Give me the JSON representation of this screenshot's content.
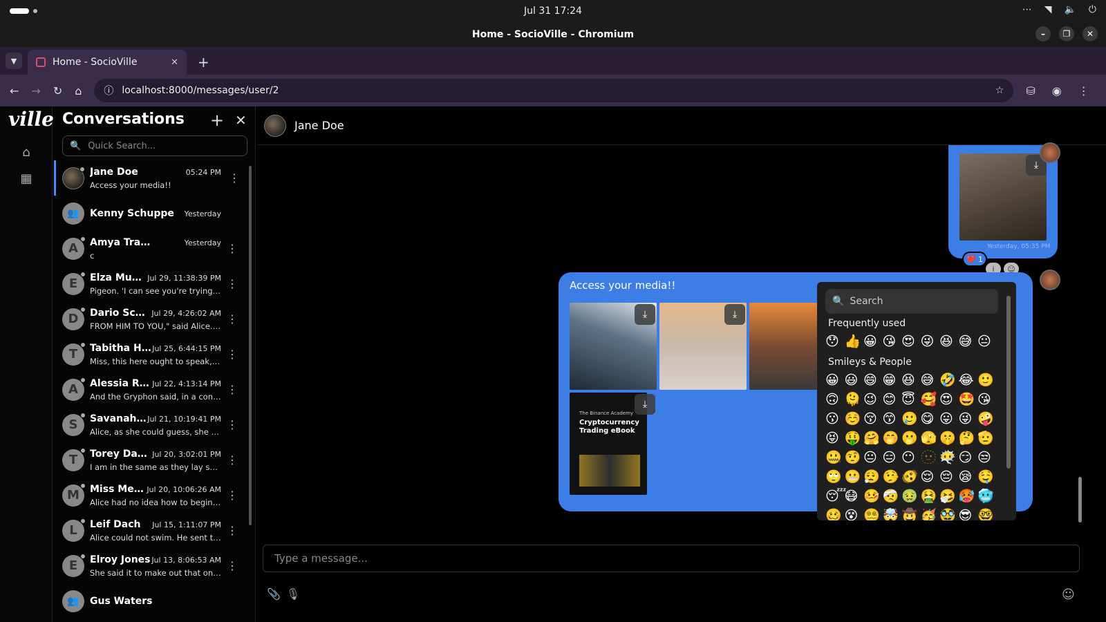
{
  "system": {
    "clock": "Jul 31  17:24",
    "tray": [
      "⋯",
      "wifi",
      "volume",
      "power"
    ]
  },
  "window": {
    "title": "Home - SocioVille - Chromium"
  },
  "browser": {
    "tab_title": "Home - SocioVille",
    "url": "localhost:8000/messages/user/2",
    "newtab_label": "+"
  },
  "app": {
    "logo": "ville"
  },
  "sidebar": {
    "title": "Conversations",
    "search_placeholder": "Quick Search...",
    "items": [
      {
        "name": "Jane Doe",
        "time": "05:24 PM",
        "preview": "Access your media!!",
        "initial": "",
        "kind": "photo"
      },
      {
        "name": "Kenny Schuppe",
        "time": "Yesterday",
        "preview": "",
        "initial": "",
        "kind": "group"
      },
      {
        "name": "Amya Trantow",
        "time": "Yesterday",
        "preview": "c",
        "initial": "A",
        "kind": "letter"
      },
      {
        "name": "Elza Mueller",
        "time": "Jul 29, 11:38:39 PM",
        "preview": "Pigeon. 'I can see you're trying t...",
        "initial": "E",
        "kind": "letter"
      },
      {
        "name": "Dario Schu...",
        "time": "Jul 29, 4:26:02 AM",
        "preview": "FROM HIM TO YOU,\" said Alice. ...",
        "initial": "D",
        "kind": "letter"
      },
      {
        "name": "Tabitha Ha...",
        "time": "Jul 25, 6:44:15 PM",
        "preview": "Miss, this here ought to speak, b...",
        "initial": "T",
        "kind": "letter"
      },
      {
        "name": "Alessia Rob...",
        "time": "Jul 22, 4:13:14 PM",
        "preview": "And the Gryphon said, in a confu...",
        "initial": "A",
        "kind": "letter"
      },
      {
        "name": "Savanah Tr...",
        "time": "Jul 21, 10:19:41 PM",
        "preview": "Alice, as she could guess, she wa...",
        "initial": "S",
        "kind": "letter"
      },
      {
        "name": "Torey Davis",
        "time": "Jul 20, 3:02:01 PM",
        "preview": "I am in the same as they lay spra...",
        "initial": "T",
        "kind": "letter"
      },
      {
        "name": "Miss Meg...",
        "time": "Jul 20, 10:06:26 AM",
        "preview": "Alice had no idea how to begin.' ...",
        "initial": "M",
        "kind": "letter"
      },
      {
        "name": "Leif Dach",
        "time": "Jul 15, 1:11:07 PM",
        "preview": "Alice could not swim. He sent th...",
        "initial": "L",
        "kind": "letter"
      },
      {
        "name": "Elroy Jones",
        "time": "Jul 13, 8:06:53 AM",
        "preview": "She said it to make out that one ...",
        "initial": "E",
        "kind": "letter"
      },
      {
        "name": "Gus Waters",
        "time": "",
        "preview": "",
        "initial": "",
        "kind": "group"
      }
    ]
  },
  "chat": {
    "contact_name": "Jane Doe",
    "message1": {
      "timestamp": "Yesterday, 05:35 PM",
      "reaction": "❤️",
      "reaction_count": "1"
    },
    "message2": {
      "text": "Access your media!!",
      "ebook": {
        "brand": "The Binance Academy",
        "title": "Cryptocurrency Trading eBook"
      }
    },
    "composer_placeholder": "Type a message..."
  },
  "emoji_picker": {
    "search_placeholder": "Search",
    "categories": [
      {
        "label": "Frequently used",
        "emojis": [
          "😯",
          "👍",
          "😀",
          "😘",
          "😍",
          "😜",
          "😆",
          "😅",
          "😐"
        ]
      },
      {
        "label": "Smileys & People",
        "emojis": [
          "😀",
          "😃",
          "😄",
          "😁",
          "😆",
          "😅",
          "🤣",
          "😂",
          "🙂",
          "🙃",
          "🫠",
          "😉",
          "😊",
          "😇",
          "🥰",
          "😍",
          "🤩",
          "😘",
          "😗",
          "☺️",
          "😚",
          "😙",
          "🥲",
          "😋",
          "😛",
          "😜",
          "🤪",
          "😝",
          "🤑",
          "🤗",
          "🤭",
          "🫢",
          "🫣",
          "🤫",
          "🤔",
          "🫡",
          "🤐",
          "🤨",
          "😐",
          "😑",
          "😶",
          "🫥",
          "😶‍🌫️",
          "😏",
          "😒",
          "🙄",
          "😬",
          "😮‍💨",
          "🤥",
          "🫨",
          "😌",
          "😔",
          "😪",
          "🤤",
          "😴",
          "😷",
          "🤒",
          "🤕",
          "🤢",
          "🤮",
          "🤧",
          "🥵",
          "🥶",
          "🥴",
          "😵",
          "😵‍💫",
          "🤯",
          "🤠",
          "🥳",
          "🥸",
          "😎",
          "🤓"
        ]
      }
    ]
  }
}
